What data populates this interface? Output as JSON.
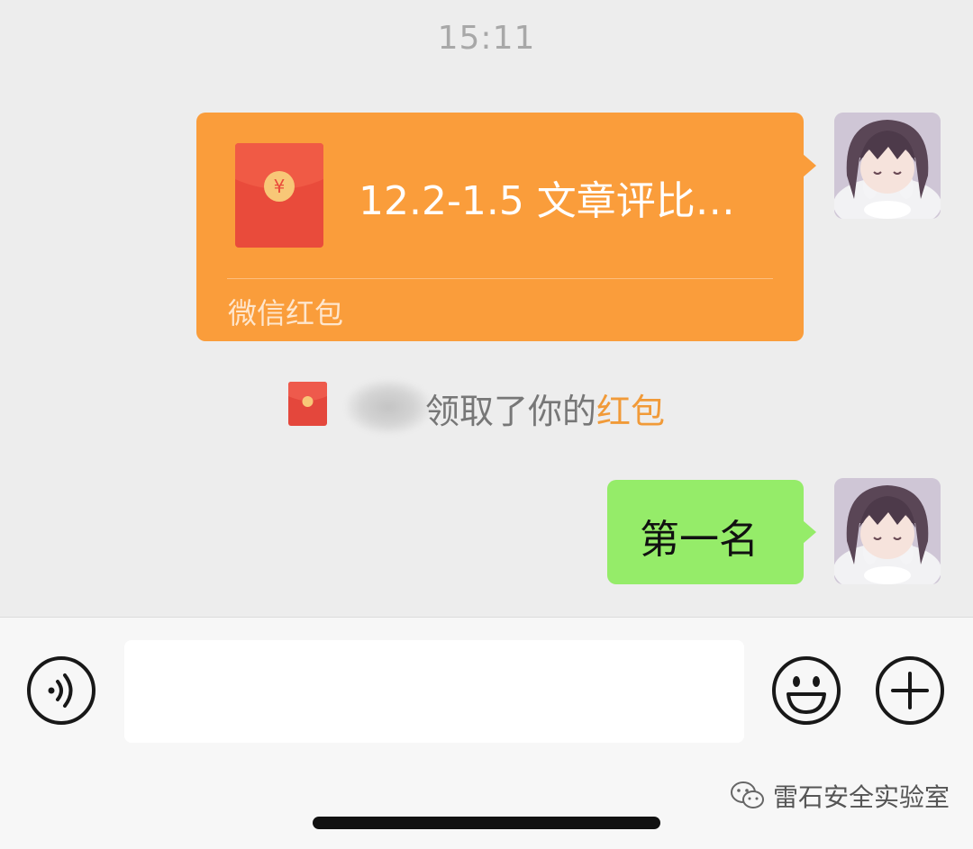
{
  "chat": {
    "timestamp": "15:11",
    "red_packet": {
      "title": "12.2-1.5 文章评比…",
      "footer": "微信红包",
      "symbol": "¥"
    },
    "notice": {
      "text": "领取了你的",
      "link": "红包"
    },
    "text_message": "第一名"
  },
  "input_bar": {
    "placeholder": "",
    "voice_icon": "voice-icon",
    "emoji_icon": "emoji-icon",
    "plus_icon": "plus-icon"
  },
  "watermark": {
    "text": "雷石安全实验室"
  },
  "colors": {
    "background": "#ededed",
    "red_packet_bubble": "#fa9d3b",
    "red_packet_icon": "#e94b3b",
    "sent_bubble": "#95ec69",
    "notice_link": "#f19a38",
    "input_bar": "#f7f7f7"
  }
}
